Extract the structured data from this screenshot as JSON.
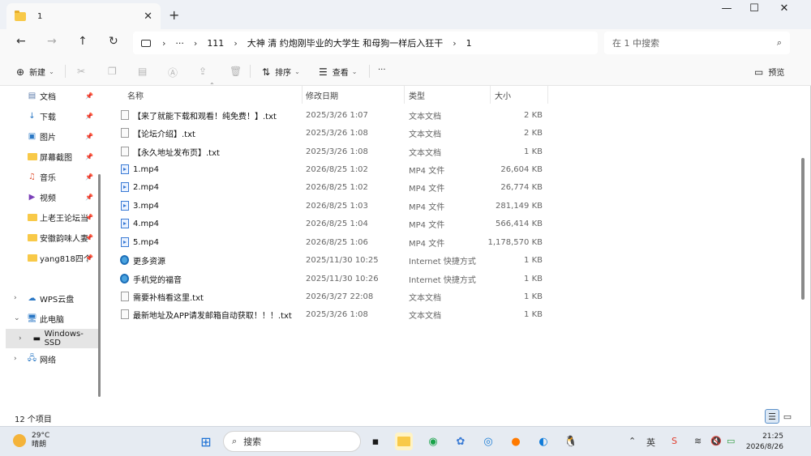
{
  "window": {
    "tab_title": "1",
    "new_tab": "+",
    "close_tab": "✕",
    "minimize": "—",
    "maximize": "☐",
    "close": "✕"
  },
  "address": {
    "more": "···",
    "crumbs": [
      "111",
      "大神 清 约炮刚毕业的大学生 和母狗一样后入狂干",
      "1"
    ],
    "search_placeholder": "在 1 中搜索"
  },
  "toolbar": {
    "new_label": "新建",
    "sort_label": "排序",
    "view_label": "查看",
    "more": "···",
    "preview_label": "预览"
  },
  "sidebar": {
    "items": [
      {
        "label": "文档",
        "icon": "document-icon",
        "pinned": true
      },
      {
        "label": "下载",
        "icon": "download-icon",
        "pinned": true
      },
      {
        "label": "图片",
        "icon": "picture-icon",
        "pinned": true
      },
      {
        "label": "屏幕截图",
        "icon": "folder-icon",
        "pinned": true
      },
      {
        "label": "音乐",
        "icon": "music-icon",
        "pinned": true
      },
      {
        "label": "视频",
        "icon": "video-icon",
        "pinned": true
      },
      {
        "label": "上老王论坛当",
        "icon": "folder-icon",
        "pinned": true
      },
      {
        "label": "安徽韵味人妻",
        "icon": "folder-icon",
        "pinned": true
      },
      {
        "label": "yang818四个",
        "icon": "folder-icon",
        "pinned": true
      }
    ],
    "tree": [
      {
        "label": "WPS云盘",
        "icon": "cloud-icon",
        "chevron": "›"
      },
      {
        "label": "此电脑",
        "icon": "computer-icon",
        "chevron": "⌄"
      },
      {
        "label": "Windows-SSD",
        "icon": "drive-icon",
        "chevron": "›"
      },
      {
        "label": "网络",
        "icon": "network-icon",
        "chevron": "›"
      }
    ]
  },
  "columns": {
    "name": "名称",
    "date": "修改日期",
    "type": "类型",
    "size": "大小"
  },
  "files": [
    {
      "name": "【来了就能下载和观看！纯免费！】.txt",
      "date": "2025/3/26 1:07",
      "type": "文本文档",
      "size": "2 KB",
      "kind": "txt"
    },
    {
      "name": "【论坛介绍】.txt",
      "date": "2025/3/26 1:08",
      "type": "文本文档",
      "size": "2 KB",
      "kind": "txt"
    },
    {
      "name": "【永久地址发布页】.txt",
      "date": "2025/3/26 1:08",
      "type": "文本文档",
      "size": "1 KB",
      "kind": "txt"
    },
    {
      "name": "1.mp4",
      "date": "2026/8/25 1:02",
      "type": "MP4 文件",
      "size": "26,604 KB",
      "kind": "mp4"
    },
    {
      "name": "2.mp4",
      "date": "2026/8/25 1:02",
      "type": "MP4 文件",
      "size": "26,774 KB",
      "kind": "mp4"
    },
    {
      "name": "3.mp4",
      "date": "2026/8/25 1:03",
      "type": "MP4 文件",
      "size": "281,149 KB",
      "kind": "mp4"
    },
    {
      "name": "4.mp4",
      "date": "2026/8/25 1:04",
      "type": "MP4 文件",
      "size": "566,414 KB",
      "kind": "mp4"
    },
    {
      "name": "5.mp4",
      "date": "2026/8/25 1:06",
      "type": "MP4 文件",
      "size": "1,178,570 KB",
      "kind": "mp4"
    },
    {
      "name": "更多资源",
      "date": "2025/11/30 10:25",
      "type": "Internet 快捷方式",
      "size": "1 KB",
      "kind": "url"
    },
    {
      "name": "手机党的福音",
      "date": "2025/11/30 10:26",
      "type": "Internet 快捷方式",
      "size": "1 KB",
      "kind": "url"
    },
    {
      "name": "需要补档看这里.txt",
      "date": "2026/3/27 22:08",
      "type": "文本文档",
      "size": "1 KB",
      "kind": "txt"
    },
    {
      "name": "最新地址及APP请发邮箱自动获取！！！.txt",
      "date": "2025/3/26 1:08",
      "type": "文本文档",
      "size": "1 KB",
      "kind": "txt"
    }
  ],
  "status": {
    "count": "12 个项目"
  },
  "taskbar": {
    "temperature": "29°C",
    "weather": "晴朗",
    "search_label": "搜索",
    "time": "21:25",
    "date": "2026/8/26",
    "tray_ime": "英"
  }
}
